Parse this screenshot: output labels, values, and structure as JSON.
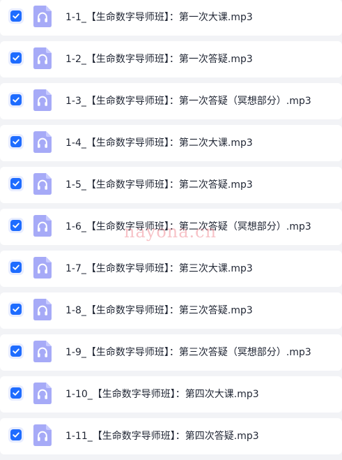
{
  "colors": {
    "checkbox": "#1e6cff",
    "checkbox_bg": "#e8edff",
    "file_icon": "#a6aaf7",
    "text": "#1f2533",
    "row_bg": "#ffffff",
    "page_bg": "#f2f3f6"
  },
  "icons": {
    "checkbox": "check-icon",
    "file": "headphones-icon"
  },
  "files": [
    {
      "name": "1-1_【生命数字导师班】：第一次大课.mp3",
      "checked": true
    },
    {
      "name": "1-2_【生命数字导师班】：第一次答疑.mp3",
      "checked": true
    },
    {
      "name": "1-3_【生命数字导师班】：第一次答疑（冥想部分）.mp3",
      "checked": true
    },
    {
      "name": "1-4_【生命数字导师班】：第二次大课.mp3",
      "checked": true
    },
    {
      "name": "1-5_【生命数字导师班】：第二次答疑.mp3",
      "checked": true
    },
    {
      "name": "1-6_【生命数字导师班】：第二次答疑（冥想部分）.mp3",
      "checked": true
    },
    {
      "name": "1-7_【生命数字导师班】：第三次大课.mp3",
      "checked": true
    },
    {
      "name": "1-8_【生命数字导师班】：第三次答疑.mp3",
      "checked": true
    },
    {
      "name": "1-9_【生命数字导师班】：第三次答疑（冥想部分）.mp3",
      "checked": true
    },
    {
      "name": "1-10_【生命数字导师班】：第四次大课.mp3",
      "checked": true
    },
    {
      "name": "1-11_【生命数字导师班】：第四次答疑.mp3",
      "checked": true
    }
  ],
  "watermark": "nayona.cn"
}
